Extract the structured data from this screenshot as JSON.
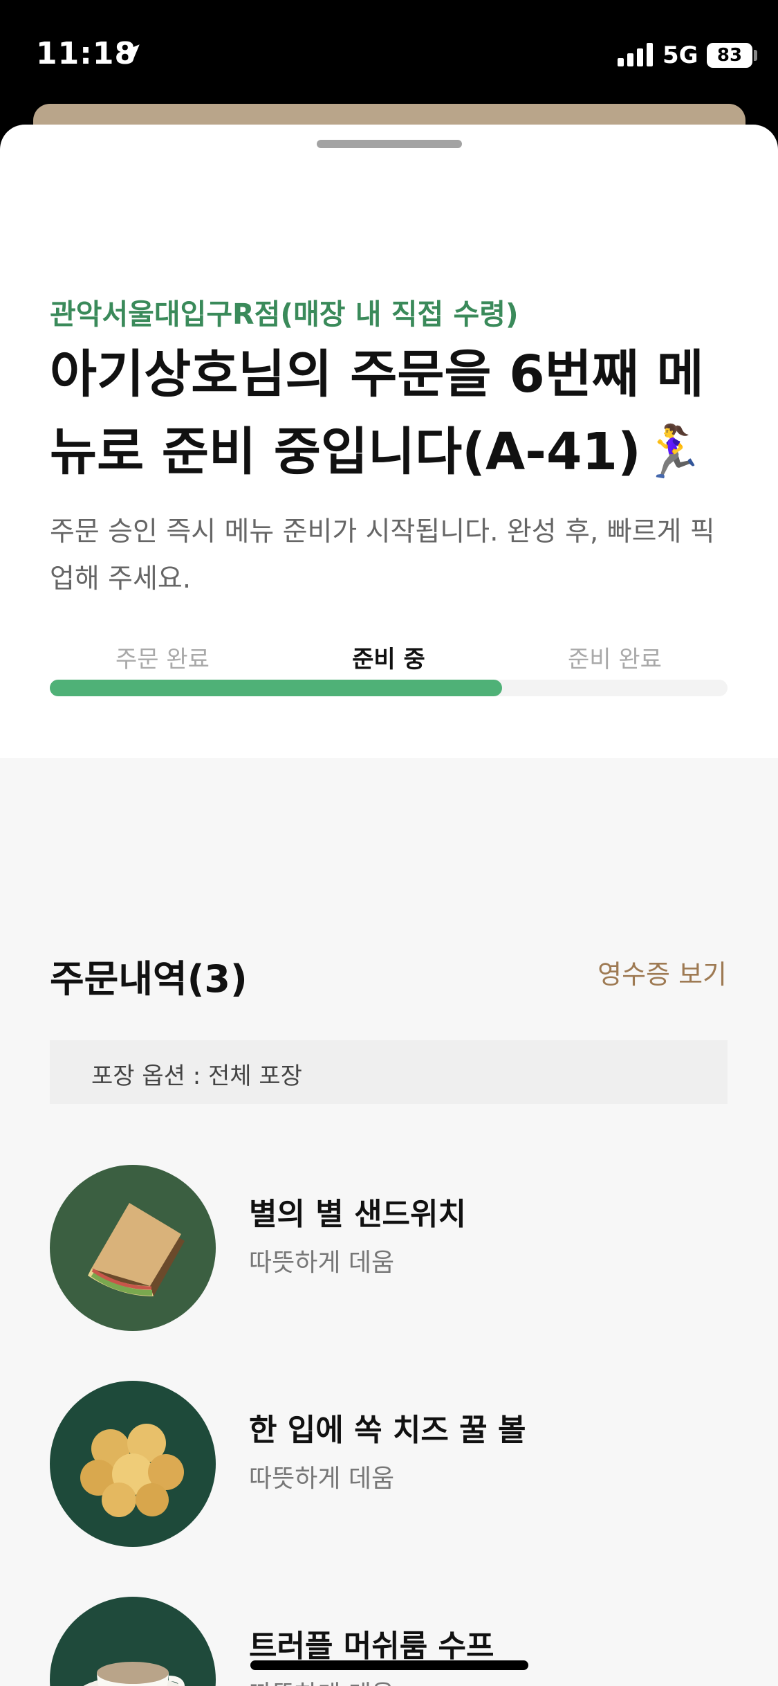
{
  "status_bar": {
    "time": "11:18",
    "network": "5G",
    "battery": "83"
  },
  "header": {
    "store": "관악서울대입구R점(매장 내 직접 수령)",
    "headline": "아기상호님의 주문을 6번째 메뉴로 준비 중입니다(A-41)🏃‍♀️",
    "subtext": "주문 승인 즉시 메뉴 준비가 시작됩니다. 완성 후, 빠르게 픽업해 주세요."
  },
  "progress": {
    "steps": [
      "주문 완료",
      "준비 중",
      "준비 완료"
    ],
    "active_index": 1,
    "fraction": 0.667
  },
  "order": {
    "title": "주문내역(3)",
    "receipt_link": "영수증 보기",
    "packaging": "포장 옵션 : 전체 포장",
    "items": [
      {
        "name": "별의 별 샌드위치",
        "option": "따뜻하게 데움",
        "icon": "sandwich-image"
      },
      {
        "name": "한 입에 쏙 치즈 꿀 볼",
        "option": "따뜻하게 데움",
        "icon": "cheese-ball-image"
      },
      {
        "name": "트러플 머쉬룸 수프",
        "option": "따뜻하게 데움",
        "icon": "soup-image"
      }
    ]
  },
  "colors": {
    "accent_green": "#4fb177",
    "store_green": "#3a8a5a",
    "link_brown": "#9e7a53",
    "thumb_dark_green": "#1f4a3b"
  }
}
